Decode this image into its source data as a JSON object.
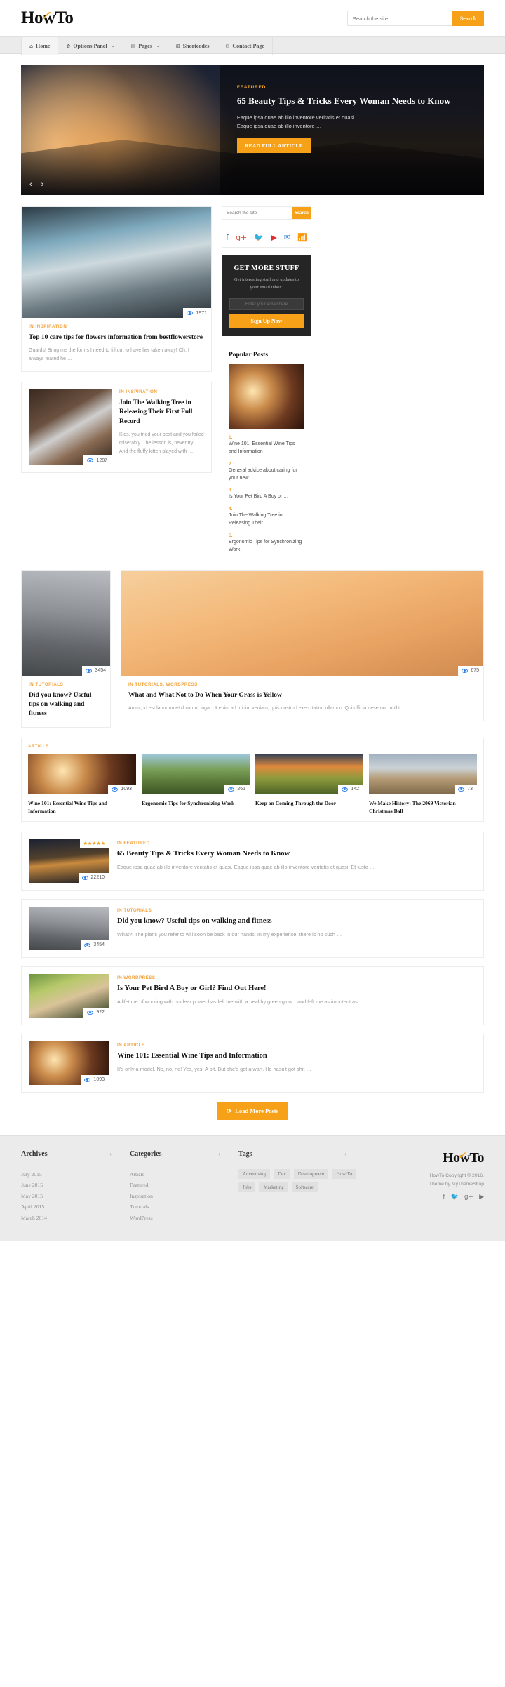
{
  "site": {
    "name": "HowTo",
    "logo_check": "✓"
  },
  "header": {
    "search_placeholder": "Search the site",
    "search_value": "",
    "search_button": "Search"
  },
  "nav": {
    "items": [
      {
        "label": "Home",
        "icon": "home-icon",
        "glyph": "⌂",
        "caret": "",
        "active": true
      },
      {
        "label": "Options Panel",
        "icon": "gear-icon",
        "glyph": "✿",
        "caret": "⌄",
        "active": false
      },
      {
        "label": "Pages",
        "icon": "page-icon",
        "glyph": "▤",
        "caret": "⌄",
        "active": false
      },
      {
        "label": "Shortcodes",
        "icon": "grid-icon",
        "glyph": "⊞",
        "caret": "",
        "active": false
      },
      {
        "label": "Contact Page",
        "icon": "envelope-icon",
        "glyph": "✉",
        "caret": "",
        "active": false
      }
    ]
  },
  "hero": {
    "kicker": "FEATURED",
    "title": "65 Beauty Tips & Tricks Every Woman Needs to Know",
    "excerpt": "Eaque ipsa quae ab illo inventore veritatis et quasi. Eaque ipsa quae ab illo inventore …",
    "button": "READ FULL ARTICLE",
    "prev": "‹",
    "next": "›"
  },
  "featured_post": {
    "category": "IN INSPIRATION",
    "title": "Top 10 care tips for flowers information from bestflowerstore",
    "excerpt": "Guards! Bring me the forms I need to fill out to have her taken away! Oh, I always feared he …",
    "views": "1971"
  },
  "second_post": {
    "category": "IN INSPIRATION",
    "title": "Join The Walking Tree in Releasing Their First Full Record",
    "excerpt": "Kids, you tried your best and you failed miserably. The lesson is, never try. …And the fluffy kitten played with …",
    "views": "1287"
  },
  "sidebar": {
    "search_placeholder": "Search the site",
    "search_value": "",
    "search_button": "Search",
    "social": [
      {
        "name": "facebook-icon",
        "glyph": "f",
        "color": "#3b5998"
      },
      {
        "name": "google-plus-icon",
        "glyph": "g+",
        "color": "#dd4b39"
      },
      {
        "name": "twitter-icon",
        "glyph": "🐦",
        "color": "#4ab3f4"
      },
      {
        "name": "youtube-icon",
        "glyph": "▶",
        "color": "#e02f2f"
      },
      {
        "name": "email-icon",
        "glyph": "✉",
        "color": "#4a90d9"
      },
      {
        "name": "rss-icon",
        "glyph": "📶",
        "color": "#f7931e"
      }
    ],
    "optin": {
      "heading": "GET MORE STUFF",
      "text": "Get interesting stuff and updates to your email inbox.",
      "input_placeholder": "Enter your email here",
      "input_value": "",
      "button": "Sign Up Now"
    },
    "popular": {
      "heading": "Popular Posts",
      "items": [
        {
          "num": "1.",
          "title": "Wine 101: Essential Wine Tips and Information"
        },
        {
          "num": "2.",
          "title": "General advice about caring for your new …"
        },
        {
          "num": "3.",
          "title": "Is Your Pet Bird A Boy or …"
        },
        {
          "num": "4.",
          "title": "Join The Walking Tree in Releasing Their …"
        },
        {
          "num": "5.",
          "title": "Ergonomic Tips for Synchronizing Work"
        }
      ]
    }
  },
  "row_posts": {
    "left": {
      "category": "IN TUTORIALS",
      "title": "Did you know? Useful tips on walking and fitness",
      "views": "3454"
    },
    "right": {
      "category": "IN TUTORIALS, WORDPRESS",
      "title": "What and What Not to Do When Your Grass is Yellow",
      "excerpt": "Animi, id est laborum et dolorum fuga. Ut enim ad minim veniam, quis nostrud exercitation ullamco. Qui officia deserunt mollit …",
      "views": "675"
    }
  },
  "article_grid": {
    "tag": "ARTICLE",
    "items": [
      {
        "title": "Wine 101: Essential Wine Tips and Information",
        "views": "1093",
        "photo": "ph-wine"
      },
      {
        "title": "Ergonomic Tips for Synchronizing Work",
        "views": "261",
        "photo": "ph-chair"
      },
      {
        "title": "Keep on Coming Through the Door",
        "views": "142",
        "photo": "ph-sunset"
      },
      {
        "title": "We Make History: The 2069 Victorian Christmas Ball",
        "views": "73",
        "photo": "ph-castle"
      }
    ]
  },
  "list_posts": [
    {
      "category": "IN FEATURED",
      "title": "65 Beauty Tips & Tricks Every Woman Needs to Know",
      "excerpt": "Eaque ipsa quae ab illo inventore veritatis et quasi. Eaque ipsa quae ab illo inventore veritatis et quasi. Et iusto …",
      "views": "22210",
      "stars": "★★★★★",
      "photo": "ph-night"
    },
    {
      "category": "IN TUTORIALS",
      "title": "Did you know? Useful tips on walking and fitness",
      "excerpt": "What?! The plans you refer to will soon be back in our hands. In my experience, there is no such …",
      "views": "3454",
      "stars": "",
      "photo": "ph-street"
    },
    {
      "category": "IN WORDPRESS",
      "title": "Is Your Pet Bird A Boy or Girl? Find Out Here!",
      "excerpt": "A lifetime of working with nuclear power has left me with a healthy green glow…and left me as impotent as …",
      "views": "922",
      "stars": "",
      "photo": "ph-bird"
    },
    {
      "category": "IN ARTICLE",
      "title": "Wine 101: Essential Wine Tips and Information",
      "excerpt": "It's only a model. No, no, no! Yes, yes. A bit. But she's got a wart. He hasn't got shit …",
      "views": "1093",
      "stars": "",
      "photo": "ph-wine"
    }
  ],
  "load_more": {
    "label": "Load More Posts",
    "icon": "refresh-icon",
    "glyph": "⟳"
  },
  "footer": {
    "columns": [
      {
        "heading": "Archives",
        "chevron": "›",
        "links": [
          "July 2015",
          "June 2015",
          "May 2015",
          "April 2015",
          "March 2014"
        ]
      },
      {
        "heading": "Categories",
        "chevron": "›",
        "links": [
          "Article",
          "Featured",
          "Inspiration",
          "Tutorials",
          "WordPress"
        ]
      }
    ],
    "tags_heading": "Tags",
    "tags_chevron": "›",
    "tags": [
      "Advertising",
      "Dev",
      "Development",
      "How To",
      "Jobs",
      "Marketing",
      "Software"
    ],
    "copyright_line1": "HowTo Copyright © 2016.",
    "copyright_line2": "Theme by MyThemeShop",
    "social": [
      {
        "name": "facebook-icon",
        "glyph": "f"
      },
      {
        "name": "twitter-icon",
        "glyph": "🐦"
      },
      {
        "name": "google-plus-icon",
        "glyph": "g+"
      },
      {
        "name": "youtube-icon",
        "glyph": "▶"
      }
    ]
  },
  "colors": {
    "accent": "#f7a118",
    "category": "#f3a23b",
    "dark": "#252525",
    "navbg": "#ebebeb"
  }
}
